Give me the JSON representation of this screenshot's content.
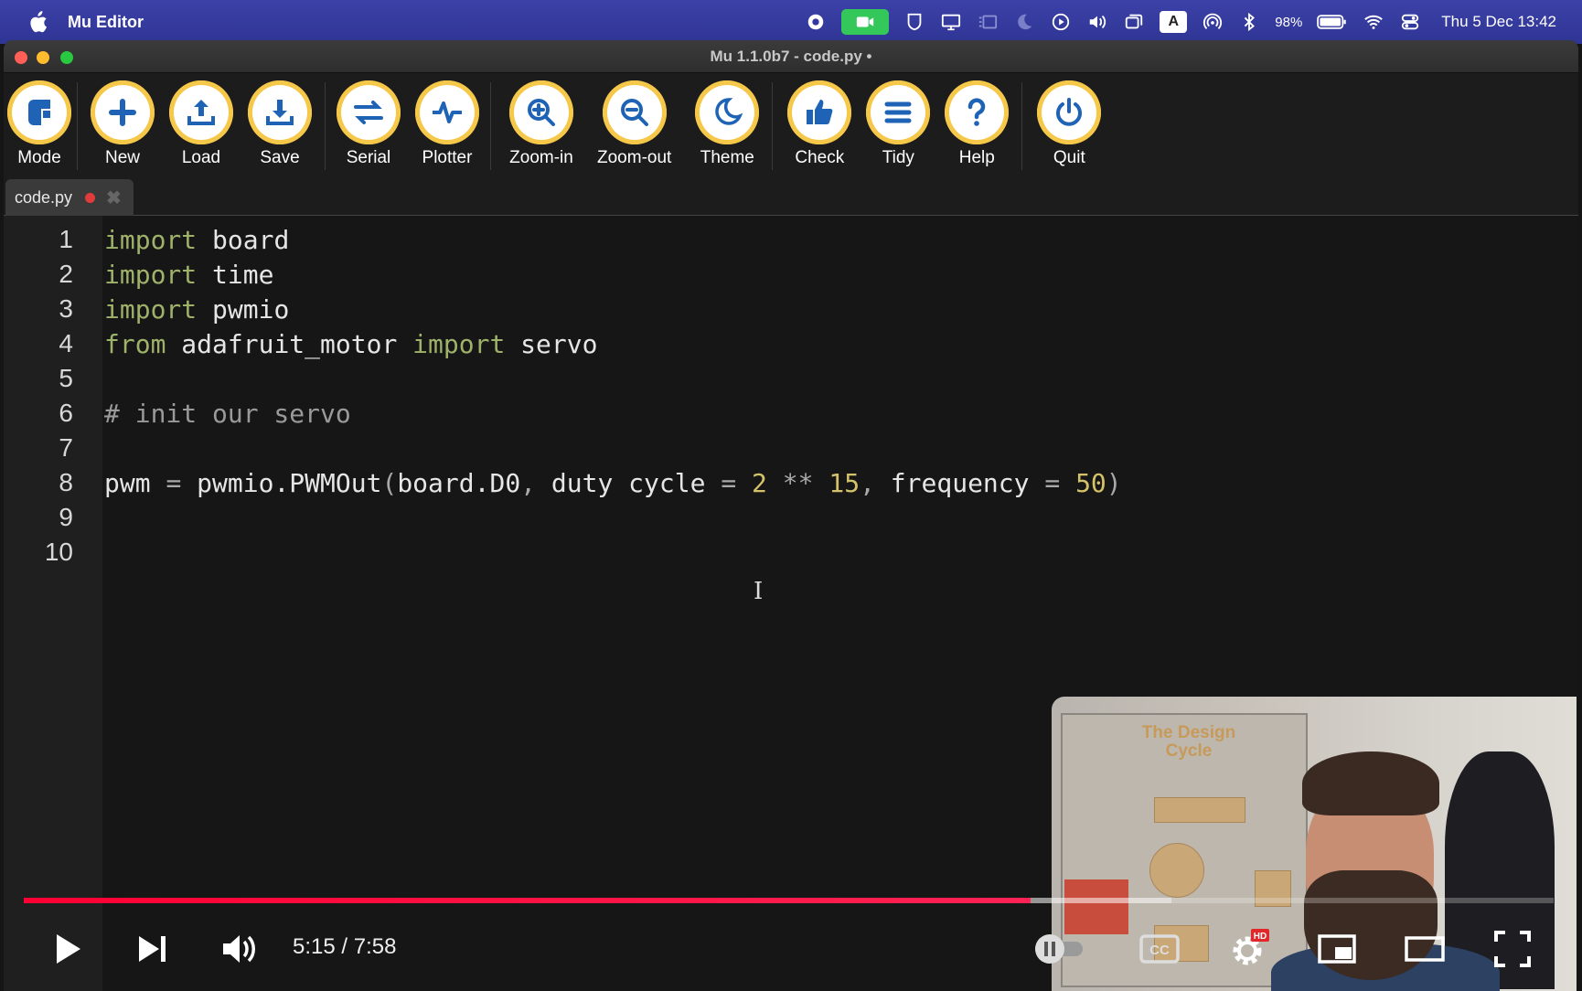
{
  "menubar": {
    "app_name": "Mu Editor",
    "battery": "98%",
    "keyboard_indicator": "A",
    "datetime": "Thu 5 Dec  13:42",
    "bg_color": "#3238a0"
  },
  "window": {
    "title": "Mu 1.1.0b7 - code.py •"
  },
  "toolbar": {
    "buttons": [
      {
        "label": "Mode",
        "icon": "mode-icon"
      },
      {
        "label": "New",
        "icon": "plus-icon"
      },
      {
        "label": "Load",
        "icon": "upload-icon"
      },
      {
        "label": "Save",
        "icon": "download-icon"
      },
      {
        "label": "Serial",
        "icon": "arrows-icon"
      },
      {
        "label": "Plotter",
        "icon": "pulse-icon"
      },
      {
        "label": "Zoom-in",
        "icon": "zoom-in-icon"
      },
      {
        "label": "Zoom-out",
        "icon": "zoom-out-icon"
      },
      {
        "label": "Theme",
        "icon": "moon-icon"
      },
      {
        "label": "Check",
        "icon": "thumbs-up-icon"
      },
      {
        "label": "Tidy",
        "icon": "lines-icon"
      },
      {
        "label": "Help",
        "icon": "question-icon"
      },
      {
        "label": "Quit",
        "icon": "power-icon"
      }
    ],
    "accent_color": "#f6c84a"
  },
  "tab": {
    "filename": "code.py",
    "close": "✖"
  },
  "editor": {
    "line_numbers": [
      "1",
      "2",
      "3",
      "4",
      "5",
      "6",
      "7",
      "8",
      "9",
      "10"
    ],
    "lines": {
      "l1": {
        "kw": "import",
        "rest": " board"
      },
      "l2": {
        "kw": "import",
        "rest": " time"
      },
      "l3": {
        "kw": "import",
        "rest": " pwmio"
      },
      "l4": {
        "kw1": "from",
        "mid": " adafruit_motor ",
        "kw2": "import",
        "rest": " servo"
      },
      "l6": {
        "comment": "# init our servo"
      },
      "l8": {
        "a": "pwm ",
        "eq1": "=",
        "b": " pwmio.PWMOut",
        "p1": "(",
        "c": "board.D0",
        "comma1": ",",
        "d": " duty cycle ",
        "eq2": "=",
        "sp1": " ",
        "n1": "2",
        "pow": " ** ",
        "n2": "15",
        "comma2": ",",
        "e": " frequency ",
        "eq3": "=",
        "sp2": " ",
        "n3": "50",
        "p2": ")"
      }
    }
  },
  "player": {
    "time": "5:15 / 7:58",
    "progress": 0.658,
    "buffered": 0.75,
    "hd_badge": "HD",
    "cc_label": "CC"
  },
  "webcam": {
    "poster_title": "The Design Cycle"
  }
}
